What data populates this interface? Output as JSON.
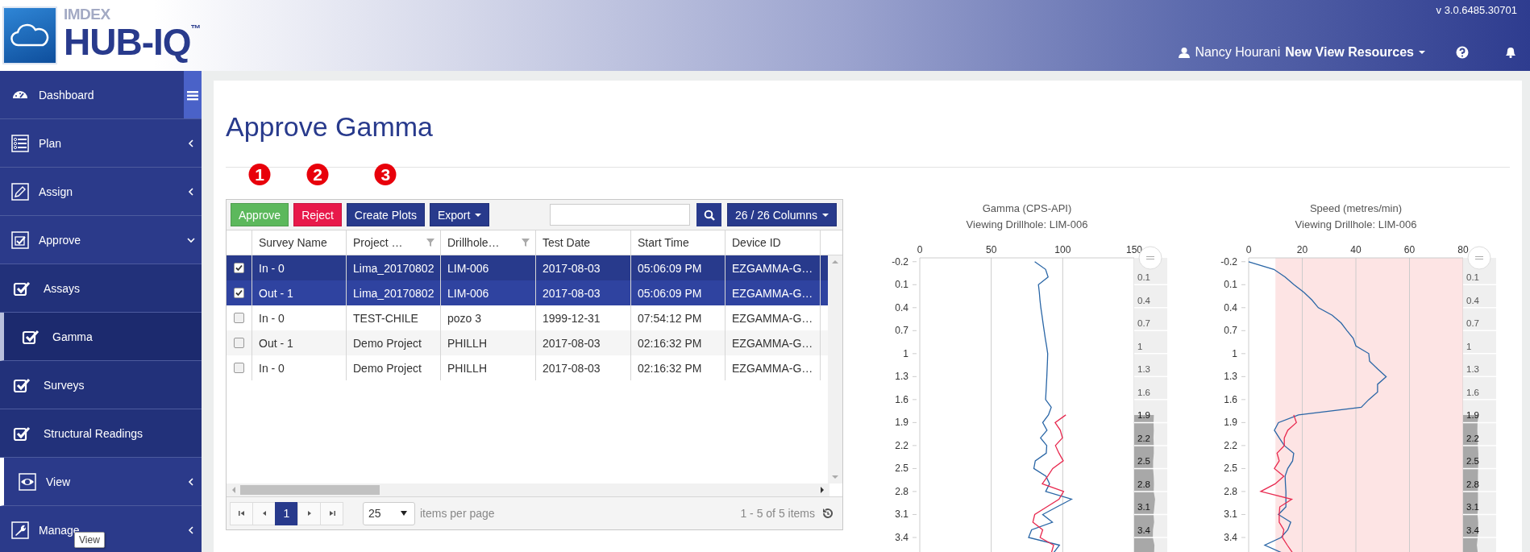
{
  "header": {
    "logo": {
      "brand": "IMDEX",
      "product": "HUB-IQ$^{™}$"
    },
    "version": "v 3.0.6485.30701",
    "user": {
      "name": "Nancy Hourani",
      "organization": "New View Resources"
    }
  },
  "sidebar": {
    "items": [
      {
        "label": "Dashboard",
        "selected": false,
        "hovered": false
      },
      {
        "label": "Plan",
        "expanded": false,
        "selected": false,
        "hovered": false
      },
      {
        "label": "Assign",
        "expanded": false,
        "selected": false,
        "hovered": false
      },
      {
        "label": "Approve",
        "expanded": true,
        "selected": false,
        "hovered": false,
        "children": [
          {
            "label": "Assays",
            "selected": false,
            "hovered": false
          },
          {
            "label": "Gamma",
            "selected": true,
            "hovered": false
          },
          {
            "label": "Surveys",
            "selected": false,
            "hovered": false
          },
          {
            "label": "Structural Readings",
            "selected": false,
            "hovered": false
          }
        ]
      },
      {
        "label": "View",
        "expanded": false,
        "selected": false,
        "hovered": true
      },
      {
        "label": "Manage",
        "expanded": false,
        "selected": false,
        "hovered": false
      }
    ],
    "tooltip": "View"
  },
  "page": {
    "title": "Approve Gamma"
  },
  "toolbar": {
    "buttons": [
      {
        "label": "Approve",
        "kind": "success",
        "badge": "1"
      },
      {
        "label": "Reject",
        "kind": "danger",
        "badge": "2"
      },
      {
        "label": "Create Plots",
        "kind": "primary",
        "badge": "3"
      },
      {
        "label": "Export",
        "kind": "dropdown"
      }
    ],
    "columns_button": "26 / 26 Columns"
  },
  "table": {
    "columns": [
      {
        "label": "Survey Name",
        "filter": false
      },
      {
        "label": "Project …",
        "filter": true
      },
      {
        "label": "Drillhole…",
        "filter": true
      },
      {
        "label": "Test Date",
        "filter": false
      },
      {
        "label": "Start Time",
        "filter": false
      },
      {
        "label": "Device ID",
        "filter": false
      }
    ],
    "rows": [
      {
        "selected": true,
        "checked": true,
        "cells": [
          "In - 0",
          "Lima_20170802",
          "LIM-006",
          "2017-08-03",
          "05:06:09 PM",
          "EZGAMMA-G…"
        ]
      },
      {
        "selected": true,
        "checked": true,
        "cells": [
          "Out - 1",
          "Lima_20170802",
          "LIM-006",
          "2017-08-03",
          "05:06:09 PM",
          "EZGAMMA-G…"
        ]
      },
      {
        "selected": false,
        "checked": false,
        "cells": [
          "In - 0",
          "TEST-CHILE",
          "pozo 3",
          "1999-12-31",
          "07:54:12 PM",
          "EZGAMMA-G…"
        ]
      },
      {
        "selected": false,
        "checked": false,
        "cells": [
          "Out - 1",
          "Demo Project",
          "PHILLH",
          "2017-08-03",
          "02:16:32 PM",
          "EZGAMMA-G…"
        ]
      },
      {
        "selected": false,
        "checked": false,
        "cells": [
          "In - 0",
          "Demo Project",
          "PHILLH",
          "2017-08-03",
          "02:16:32 PM",
          "EZGAMMA-G…"
        ]
      }
    ]
  },
  "pager": {
    "pages": [
      {
        "label": "1",
        "selected": true
      }
    ],
    "page_size": "25",
    "page_size_label": "items per page",
    "summary": "1 - 5 of 5 items"
  },
  "charts": [
    {
      "subtitle": "Viewing Drillhole: LIM-006",
      "chart_data": {
        "type": "line",
        "title": "Gamma (CPS-API)",
        "orientation": "horizontal",
        "x": [
          -0.2,
          -0.1,
          0,
          0.1,
          0.2,
          0.3,
          0.4,
          0.5,
          0.6,
          0.7,
          0.8,
          0.9,
          1,
          1.1,
          1.2,
          1.3,
          1.4,
          1.5,
          1.6,
          1.7,
          1.8,
          1.9,
          2,
          2.1,
          2.2,
          2.3,
          2.4,
          2.5,
          2.6,
          2.7,
          2.8,
          2.9,
          3,
          3.1,
          3.2,
          3.3,
          3.4,
          3.5,
          3.6
        ],
        "series": [
          {
            "color": "#2a66a6",
            "values": [
              80.4,
              88,
              89.8,
              83,
              83.6,
              84.1,
              84.7,
              85.5,
              86.2,
              87,
              87.8,
              88.7,
              89.5,
              89.3,
              89.1,
              88.9,
              88.6,
              88.3,
              88,
              92,
              90,
              86,
              89,
              84.5,
              88.8,
              88.5,
              80.8,
              79.8,
              88.3,
              90.8,
              88.1,
              106.2,
              96,
              86,
              92.8,
              78.2,
              76.1,
              97.7,
              93.6
            ]
          },
          {
            "color": "#e8294f",
            "values": [
              null,
              null,
              null,
              null,
              null,
              null,
              null,
              null,
              null,
              null,
              null,
              null,
              null,
              null,
              null,
              null,
              null,
              null,
              null,
              null,
              102.2,
              94.7,
              98.3,
              99.8,
              94.9,
              97.4,
              100.4,
              93,
              89.5,
              85.7,
              100.6,
              97.4,
              88.9,
              80.4,
              79.1,
              86,
              84.2,
              93.6,
              92.1
            ]
          }
        ],
        "xlim": [
          0,
          150
        ],
        "ylim": [
          3.6,
          -0.25
        ],
        "grid": true,
        "xticks": [
          0,
          50,
          100,
          150
        ],
        "yticks": [
          -0.2,
          0.1,
          0.4,
          0.7,
          1,
          1.3,
          1.6,
          1.9,
          2.2,
          2.5,
          2.8,
          3.1,
          3.4
        ]
      },
      "navigator": {
        "labels": [
          {
            "text": "0.1",
            "selected": false
          },
          {
            "text": "0.4",
            "selected": false
          },
          {
            "text": "0.7",
            "selected": false
          },
          {
            "text": "1",
            "selected": false
          },
          {
            "text": "1.3",
            "selected": false
          },
          {
            "text": "1.6",
            "selected": false
          },
          {
            "text": "1.9",
            "selected": true
          },
          {
            "text": "2.2",
            "selected": true
          },
          {
            "text": "2.5",
            "selected": true
          },
          {
            "text": "2.8",
            "selected": true
          },
          {
            "text": "3.1",
            "selected": true
          },
          {
            "text": "3.4",
            "selected": true
          }
        ]
      }
    },
    {
      "subtitle": "Viewing Drillhole: LIM-006",
      "chart_data": {
        "type": "line",
        "title": "Speed (metres/min)",
        "orientation": "horizontal",
        "x": [
          -0.2,
          -0.1,
          0,
          0.1,
          0.2,
          0.3,
          0.4,
          0.5,
          0.6,
          0.7,
          0.8,
          0.9,
          1,
          1.1,
          1.2,
          1.3,
          1.4,
          1.5,
          1.6,
          1.7,
          1.8,
          1.9,
          2,
          2.1,
          2.2,
          2.3,
          2.4,
          2.5,
          2.6,
          2.7,
          2.8,
          2.9,
          3,
          3.1,
          3.2,
          3.3,
          3.4,
          3.5,
          3.6
        ],
        "series": [
          {
            "color": "#2a66a6",
            "values": [
              0,
              9.4,
              13.6,
              16.9,
              20.6,
              23.6,
              26,
              31.2,
              34.5,
              36.7,
              39,
              40,
              44.8,
              45.1,
              48.1,
              51.3,
              48.1,
              48.1,
              44.8,
              42,
              18.6,
              11.1,
              9.6,
              11.4,
              13.3,
              16.8,
              16.4,
              14.6,
              13.6,
              13.7,
              13.9,
              13.9,
              13.9,
              11.1,
              15.7,
              14.6,
              12.1,
              6,
              12.4
            ]
          },
          {
            "color": "#e8294f",
            "values": [
              null,
              null,
              null,
              null,
              null,
              null,
              null,
              null,
              null,
              null,
              null,
              null,
              null,
              null,
              null,
              null,
              null,
              null,
              null,
              null,
              16.8,
              17.8,
              14.6,
              13.3,
              13.3,
              10.6,
              11.4,
              9.6,
              13.1,
              9.9,
              4.5,
              16.1,
              11.6,
              11.4,
              11.4,
              13.1,
              12.6,
              14.4,
              16.4
            ]
          }
        ],
        "xlim": [
          0,
          80
        ],
        "ylim": [
          3.6,
          -0.25
        ],
        "grid": true,
        "xticks": [
          0,
          20,
          40,
          60,
          80
        ],
        "yticks": [
          -0.2,
          0.1,
          0.4,
          0.7,
          1,
          1.3,
          1.6,
          1.9,
          2.2,
          2.5,
          2.8,
          3.1,
          3.4
        ],
        "bands": [
          {
            "axis": "x",
            "from": 10,
            "to": 80,
            "color": "#fde4e4"
          }
        ]
      },
      "navigator": {
        "labels": [
          {
            "text": "0.1",
            "selected": false
          },
          {
            "text": "0.4",
            "selected": false
          },
          {
            "text": "0.7",
            "selected": false
          },
          {
            "text": "1",
            "selected": false
          },
          {
            "text": "1.3",
            "selected": false
          },
          {
            "text": "1.6",
            "selected": false
          },
          {
            "text": "1.9",
            "selected": true
          },
          {
            "text": "2.2",
            "selected": true
          },
          {
            "text": "2.5",
            "selected": true
          },
          {
            "text": "2.8",
            "selected": true
          },
          {
            "text": "3.1",
            "selected": true
          },
          {
            "text": "3.4",
            "selected": true
          }
        ]
      }
    }
  ]
}
